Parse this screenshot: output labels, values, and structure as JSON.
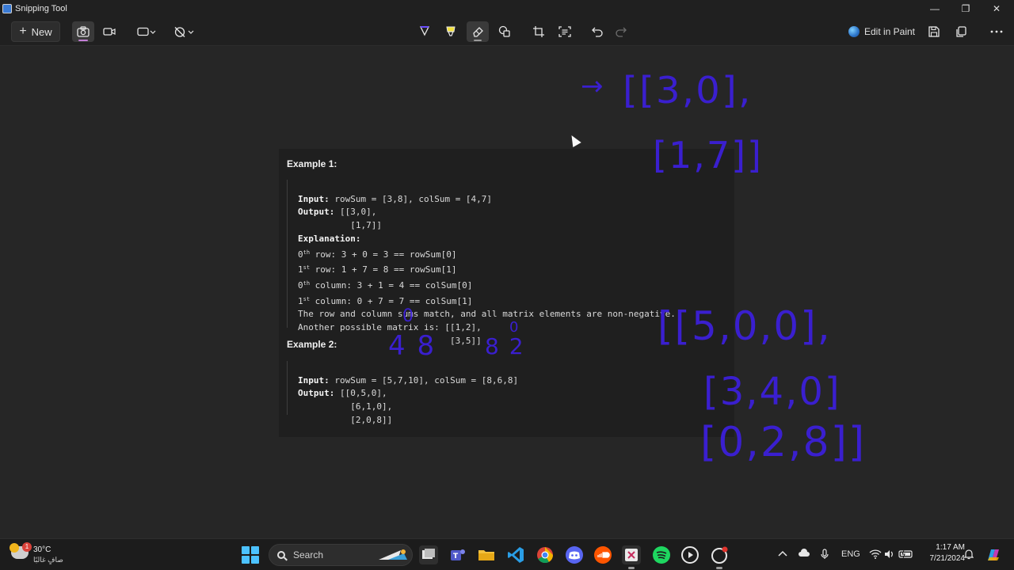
{
  "window": {
    "title": "Snipping Tool",
    "controls": [
      "—",
      "❐",
      "✕"
    ]
  },
  "toolbar": {
    "new_label": "New",
    "edit_in_paint_label": "Edit in Paint"
  },
  "snip": {
    "example1": {
      "heading": "Example 1:",
      "input_label": "Input:",
      "input_text": " rowSum = [3,8], colSum = [4,7]",
      "output_label": "Output:",
      "output_line1": " [[3,0],",
      "output_line2": "          [1,7]]",
      "explanation_label": "Explanation:",
      "lines": [
        {
          "n": "0",
          "sup": "th",
          "text": " row: 3 + 0 = 3 == rowSum[0]"
        },
        {
          "n": "1",
          "sup": "st",
          "text": " row: 1 + 7 = 8 == rowSum[1]"
        },
        {
          "n": "0",
          "sup": "th",
          "text": " column: 3 + 1 = 4 == colSum[0]"
        },
        {
          "n": "1",
          "sup": "st",
          "text": " column: 0 + 7 = 7 == colSum[1]"
        }
      ],
      "summary": "The row and column sums match, and all matrix elements are non-negative.",
      "another_line1": "Another possible matrix is: [[1,2],",
      "another_line2": "                             [3,5]]"
    },
    "example2": {
      "heading": "Example 2:",
      "input_label": "Input:",
      "input_text": " rowSum = [5,7,10], colSum = [8,6,8]",
      "output_label": "Output:",
      "output_line1": " [[0,5,0],",
      "output_line2": "          [6,1,0],",
      "output_line3": "          [2,0,8]]"
    }
  },
  "ink": {
    "arrow": "→",
    "row1": "[[3,0],",
    "row2": "[1,7]]",
    "m_row1": "[[5,0,0],",
    "m_row2": "[3,4,0]",
    "m_row3": "[0,2,8]]",
    "scribble_a": "0",
    "scribble_b": "4 8",
    "scribble_c": "8 2",
    "scribble_d": "0",
    "color": "#3a1fcf"
  },
  "taskbar": {
    "weather_temp": "30°C",
    "weather_condition": "صافٍ غالبًا",
    "weather_badge": "1",
    "search_label": "Search",
    "language": "ENG",
    "time": "1:17 AM",
    "date": "7/21/2024"
  }
}
